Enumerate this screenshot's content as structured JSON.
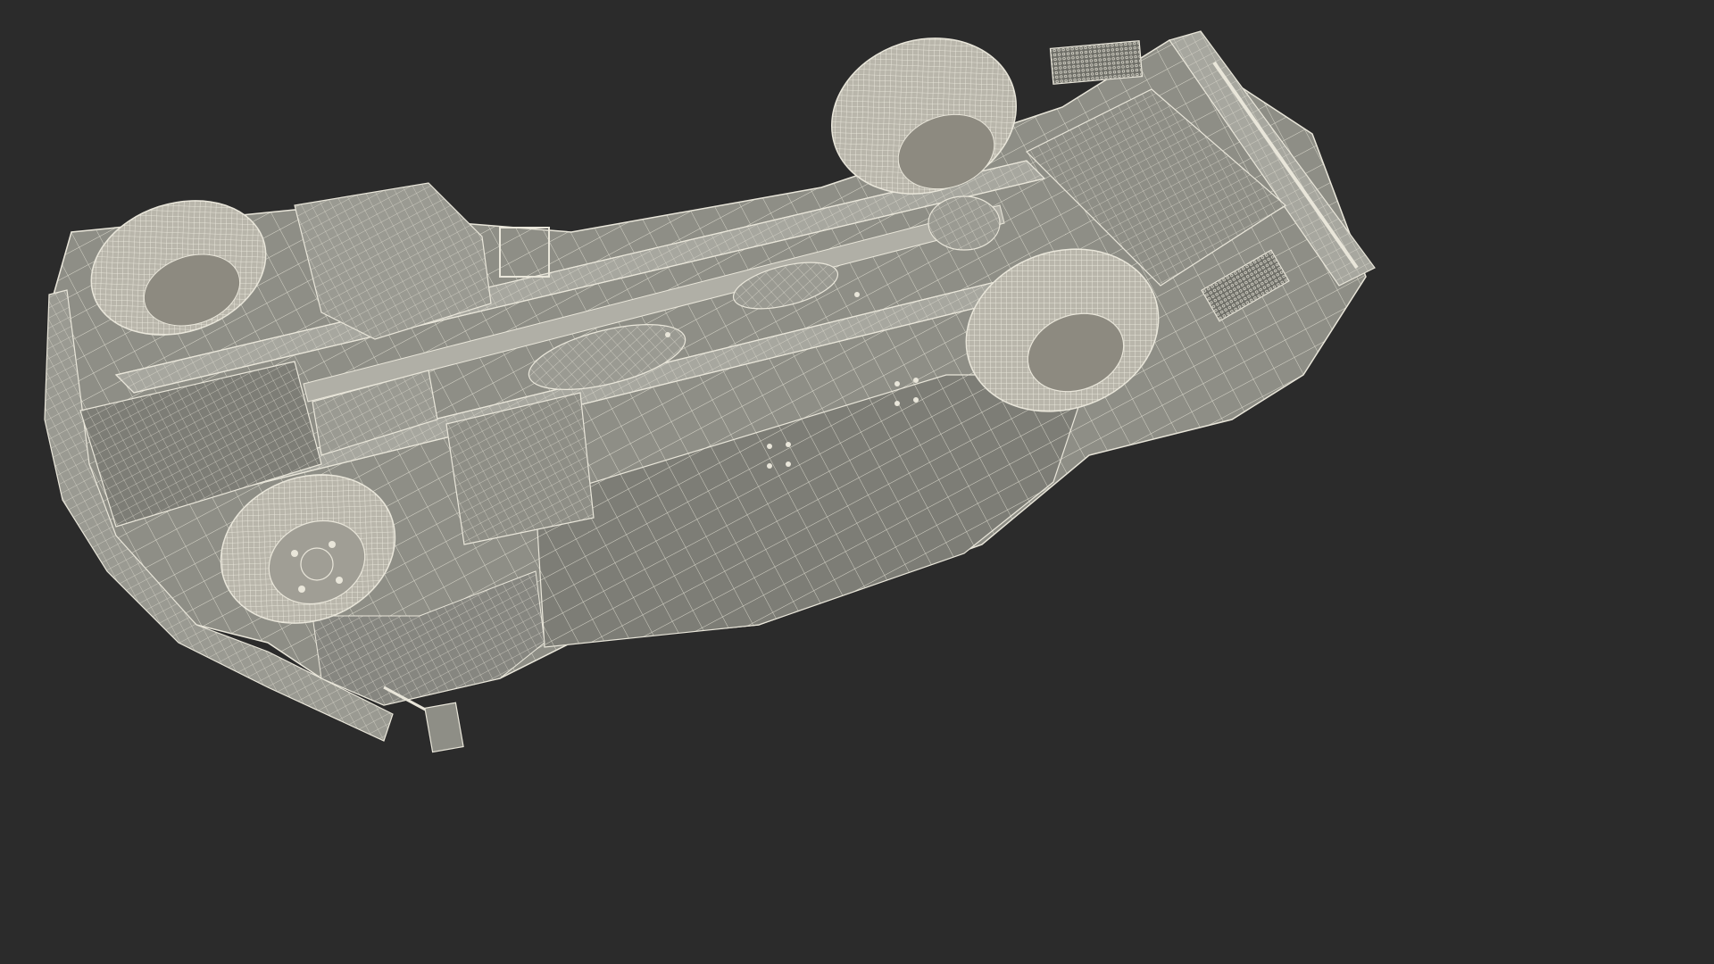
{
  "scene": {
    "background_color": "#2b2b2b",
    "subject": "truck-chassis-wireframe-underside",
    "colors": {
      "body_fill": "#8e8e86",
      "body_dark": "#6f6f68",
      "body_light": "#a7a79f",
      "wire": "#e9e6da",
      "tire": "#b9b6ab",
      "tire_dark": "#8d8a80"
    }
  }
}
